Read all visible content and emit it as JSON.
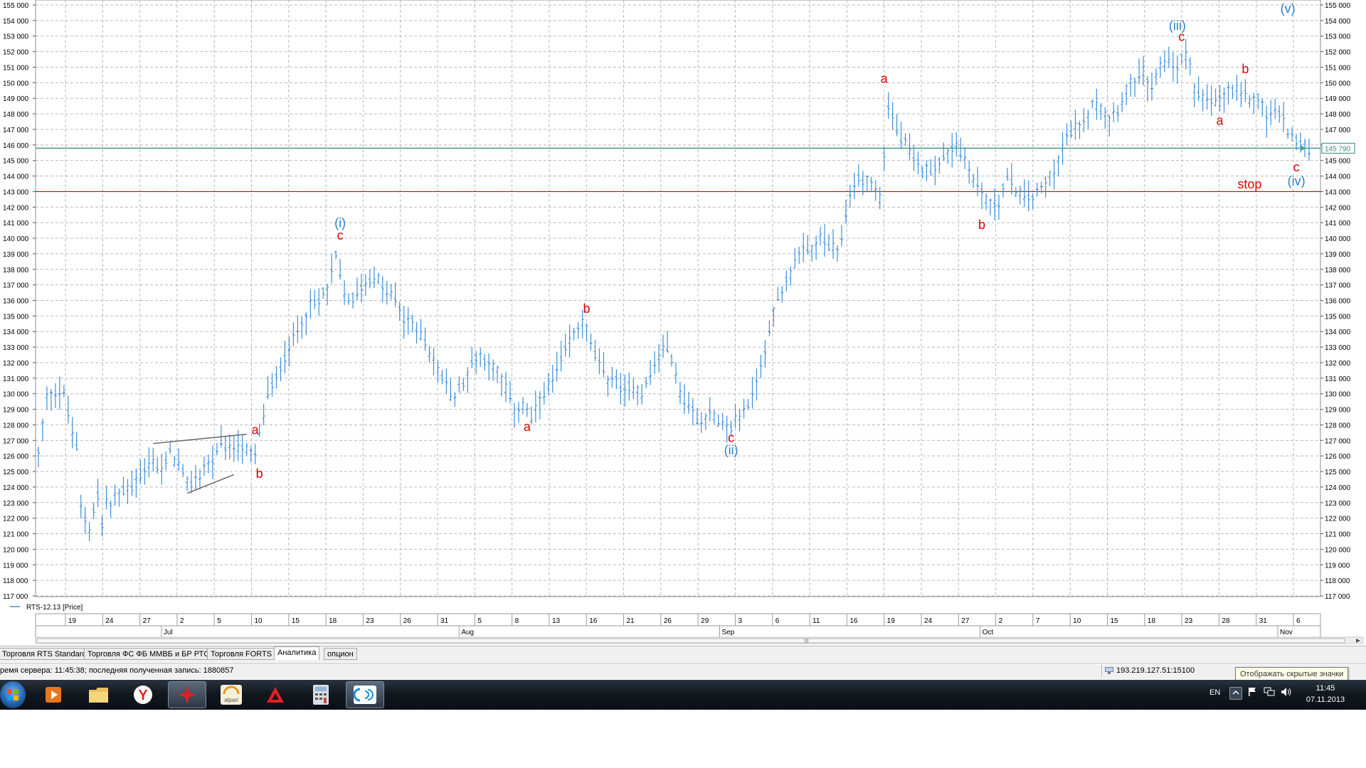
{
  "chart_data": {
    "type": "bar",
    "instrument_label": "RTS-12.13 [Price]",
    "y_ticks": [
      "117 000",
      "118 000",
      "119 000",
      "120 000",
      "121 000",
      "122 000",
      "123 000",
      "124 000",
      "125 000",
      "126 000",
      "127 000",
      "128 000",
      "129 000",
      "130 000",
      "131 000",
      "132 000",
      "133 000",
      "134 000",
      "135 000",
      "136 000",
      "137 000",
      "138 000",
      "139 000",
      "140 000",
      "141 000",
      "142 000",
      "143 000",
      "144 000",
      "145 000",
      "146 000",
      "147 000",
      "148 000",
      "149 000",
      "150 000",
      "151 000",
      "152 000",
      "153 000",
      "154 000",
      "155 000"
    ],
    "ylim": [
      117000,
      155000
    ],
    "x_ticks": [
      "19",
      "24",
      "27",
      "2",
      "5",
      "10",
      "15",
      "18",
      "23",
      "26",
      "31",
      "5",
      "8",
      "13",
      "16",
      "21",
      "26",
      "29",
      "3",
      "6",
      "11",
      "16",
      "19",
      "24",
      "27",
      "2",
      "7",
      "10",
      "15",
      "18",
      "23",
      "28",
      "31",
      "6"
    ],
    "months": [
      "Jul",
      "Aug",
      "Sep",
      "Oct",
      "Nov"
    ],
    "price_path": [
      [
        0,
        126000
      ],
      [
        2,
        129800
      ],
      [
        4,
        130200
      ],
      [
        6,
        130000
      ],
      [
        8,
        127500
      ],
      [
        9,
        126500
      ],
      [
        10,
        122800
      ],
      [
        12,
        121500
      ],
      [
        13,
        122500
      ],
      [
        14,
        123500
      ],
      [
        15,
        121500
      ],
      [
        16,
        123000
      ],
      [
        17,
        122800
      ],
      [
        19,
        123500
      ],
      [
        21,
        124000
      ],
      [
        23,
        124400
      ],
      [
        25,
        125000
      ],
      [
        27,
        125800
      ],
      [
        29,
        125000
      ],
      [
        31,
        126200
      ],
      [
        33,
        125500
      ],
      [
        35,
        124000
      ],
      [
        37,
        124500
      ],
      [
        39,
        125300
      ],
      [
        41,
        125700
      ],
      [
        43,
        126600
      ],
      [
        45,
        126200
      ],
      [
        47,
        126800
      ],
      [
        49,
        126200
      ],
      [
        51,
        125800
      ],
      [
        52,
        127500
      ],
      [
        54,
        130000
      ],
      [
        56,
        131000
      ],
      [
        58,
        132500
      ],
      [
        60,
        133500
      ],
      [
        62,
        134800
      ],
      [
        64,
        135500
      ],
      [
        66,
        136000
      ],
      [
        68,
        136800
      ],
      [
        70,
        138800
      ],
      [
        72,
        136500
      ],
      [
        74,
        136000
      ],
      [
        76,
        137000
      ],
      [
        78,
        137500
      ],
      [
        80,
        137200
      ],
      [
        82,
        136500
      ],
      [
        84,
        136000
      ],
      [
        86,
        134700
      ],
      [
        88,
        134500
      ],
      [
        90,
        134000
      ],
      [
        92,
        132600
      ],
      [
        94,
        131500
      ],
      [
        96,
        130500
      ],
      [
        98,
        129800
      ],
      [
        100,
        130700
      ],
      [
        102,
        132000
      ],
      [
        104,
        132500
      ],
      [
        106,
        132000
      ],
      [
        108,
        131300
      ],
      [
        110,
        130300
      ],
      [
        112,
        129000
      ],
      [
        114,
        129200
      ],
      [
        116,
        128300
      ],
      [
        118,
        129500
      ],
      [
        120,
        130300
      ],
      [
        122,
        131500
      ],
      [
        124,
        132800
      ],
      [
        126,
        133800
      ],
      [
        128,
        134800
      ],
      [
        130,
        133200
      ],
      [
        132,
        131800
      ],
      [
        134,
        131000
      ],
      [
        136,
        130900
      ],
      [
        138,
        130000
      ],
      [
        140,
        130600
      ],
      [
        142,
        130100
      ],
      [
        144,
        131300
      ],
      [
        146,
        132500
      ],
      [
        148,
        133200
      ],
      [
        150,
        131000
      ],
      [
        152,
        129600
      ],
      [
        154,
        128800
      ],
      [
        156,
        128400
      ],
      [
        158,
        128900
      ],
      [
        160,
        128000
      ],
      [
        162,
        127800
      ],
      [
        164,
        128200
      ],
      [
        166,
        128900
      ],
      [
        168,
        129900
      ],
      [
        170,
        131800
      ],
      [
        172,
        134000
      ],
      [
        174,
        136200
      ],
      [
        176,
        137300
      ],
      [
        178,
        138500
      ],
      [
        180,
        139000
      ],
      [
        182,
        139200
      ],
      [
        184,
        140000
      ],
      [
        186,
        139500
      ],
      [
        188,
        139000
      ],
      [
        190,
        141500
      ],
      [
        192,
        143600
      ],
      [
        194,
        143900
      ],
      [
        196,
        143500
      ],
      [
        198,
        142500
      ],
      [
        200,
        148500
      ],
      [
        202,
        147000
      ],
      [
        204,
        146000
      ],
      [
        206,
        145000
      ],
      [
        208,
        144500
      ],
      [
        210,
        144600
      ],
      [
        212,
        144800
      ],
      [
        214,
        145500
      ],
      [
        216,
        146000
      ],
      [
        218,
        145000
      ],
      [
        220,
        143800
      ],
      [
        222,
        143000
      ],
      [
        224,
        142000
      ],
      [
        226,
        142500
      ],
      [
        228,
        143800
      ],
      [
        230,
        143200
      ],
      [
        232,
        142600
      ],
      [
        234,
        142700
      ],
      [
        236,
        143200
      ],
      [
        238,
        144000
      ],
      [
        240,
        145000
      ],
      [
        242,
        146500
      ],
      [
        244,
        147000
      ],
      [
        246,
        147600
      ],
      [
        248,
        148800
      ],
      [
        250,
        148600
      ],
      [
        252,
        147800
      ],
      [
        254,
        148400
      ],
      [
        256,
        149500
      ],
      [
        258,
        150200
      ],
      [
        260,
        150500
      ],
      [
        262,
        149500
      ],
      [
        264,
        151200
      ],
      [
        266,
        151600
      ],
      [
        268,
        151000
      ],
      [
        270,
        151800
      ],
      [
        271,
        151500
      ],
      [
        272,
        149600
      ],
      [
        274,
        149000
      ],
      [
        276,
        148600
      ],
      [
        278,
        148900
      ],
      [
        280,
        149400
      ],
      [
        282,
        149500
      ],
      [
        284,
        149100
      ],
      [
        286,
        149000
      ],
      [
        288,
        148700
      ],
      [
        289,
        147600
      ],
      [
        291,
        148200
      ],
      [
        293,
        147600
      ],
      [
        295,
        146500
      ],
      [
        297,
        146000
      ],
      [
        299,
        145800
      ]
    ],
    "bars_total": 300,
    "horizontal_lines": [
      {
        "name": "current-price-line",
        "value": 145790,
        "color": "#2e8b7a"
      },
      {
        "name": "stop-line",
        "value": 143000,
        "color": "#e00000"
      }
    ],
    "current_price_label": "145 790",
    "wave_labels": [
      {
        "text": "a",
        "bar": 51,
        "price": 127400,
        "color": "red"
      },
      {
        "text": "b",
        "bar": 52,
        "price": 124600,
        "color": "red"
      },
      {
        "text": "c",
        "bar": 71,
        "price": 139900,
        "color": "red"
      },
      {
        "text": "(i)",
        "bar": 71,
        "price": 140700,
        "color": "blue"
      },
      {
        "text": "a",
        "bar": 115,
        "price": 127600,
        "color": "red"
      },
      {
        "text": "b",
        "bar": 129,
        "price": 135200,
        "color": "red"
      },
      {
        "text": "c",
        "bar": 163,
        "price": 126900,
        "color": "red"
      },
      {
        "text": "(ii)",
        "bar": 163,
        "price": 126100,
        "color": "blue"
      },
      {
        "text": "a",
        "bar": 199,
        "price": 150000,
        "color": "red"
      },
      {
        "text": "b",
        "bar": 222,
        "price": 140600,
        "color": "red"
      },
      {
        "text": "c",
        "bar": 269,
        "price": 152700,
        "color": "red"
      },
      {
        "text": "(iii)",
        "bar": 268,
        "price": 153400,
        "color": "blue"
      },
      {
        "text": "a",
        "bar": 278,
        "price": 147300,
        "color": "red"
      },
      {
        "text": "b",
        "bar": 284,
        "price": 150600,
        "color": "red"
      },
      {
        "text": "stop",
        "bar": 285,
        "price": 143200,
        "color": "red"
      },
      {
        "text": "c",
        "bar": 296,
        "price": 144300,
        "color": "red"
      },
      {
        "text": "(iv)",
        "bar": 296,
        "price": 143400,
        "color": "blue"
      },
      {
        "text": "(v)",
        "bar": 294,
        "price": 154500,
        "color": "blue"
      }
    ],
    "triangle_lines": [
      {
        "from": [
          27,
          126800
        ],
        "to": [
          49,
          127400
        ]
      },
      {
        "from": [
          35,
          123600
        ],
        "to": [
          46,
          124800
        ]
      }
    ]
  },
  "colors": {
    "bars": "#3d8fdc",
    "grid": "#b9b9b9",
    "current_line": "#2e8b7a",
    "stop_line": "#e00000"
  },
  "tabs": [
    "Торговля RTS Standard",
    "Торговля ФС ФБ ММВБ и БР РТС",
    "Торговля FORTS",
    "Аналитика",
    "опцион"
  ],
  "active_tab_index": 3,
  "status": {
    "server_time": "ремя сервера: 11:45:38; последняя полученная запись: 1880857",
    "server_address": "193.219.127.51:15100",
    "tooltip": "Отображать скрытые значки"
  },
  "taskbar": {
    "apps": [
      "media-player-icon",
      "file-explorer-icon",
      "yandex-browser-icon",
      "trading-terminal-icon",
      "alpari-icon",
      "alor-icon",
      "calculator-icon",
      "analytics-app-icon"
    ],
    "alpari_label": "alpari",
    "language": "EN",
    "time": "11:45",
    "date": "07.11.2013"
  }
}
